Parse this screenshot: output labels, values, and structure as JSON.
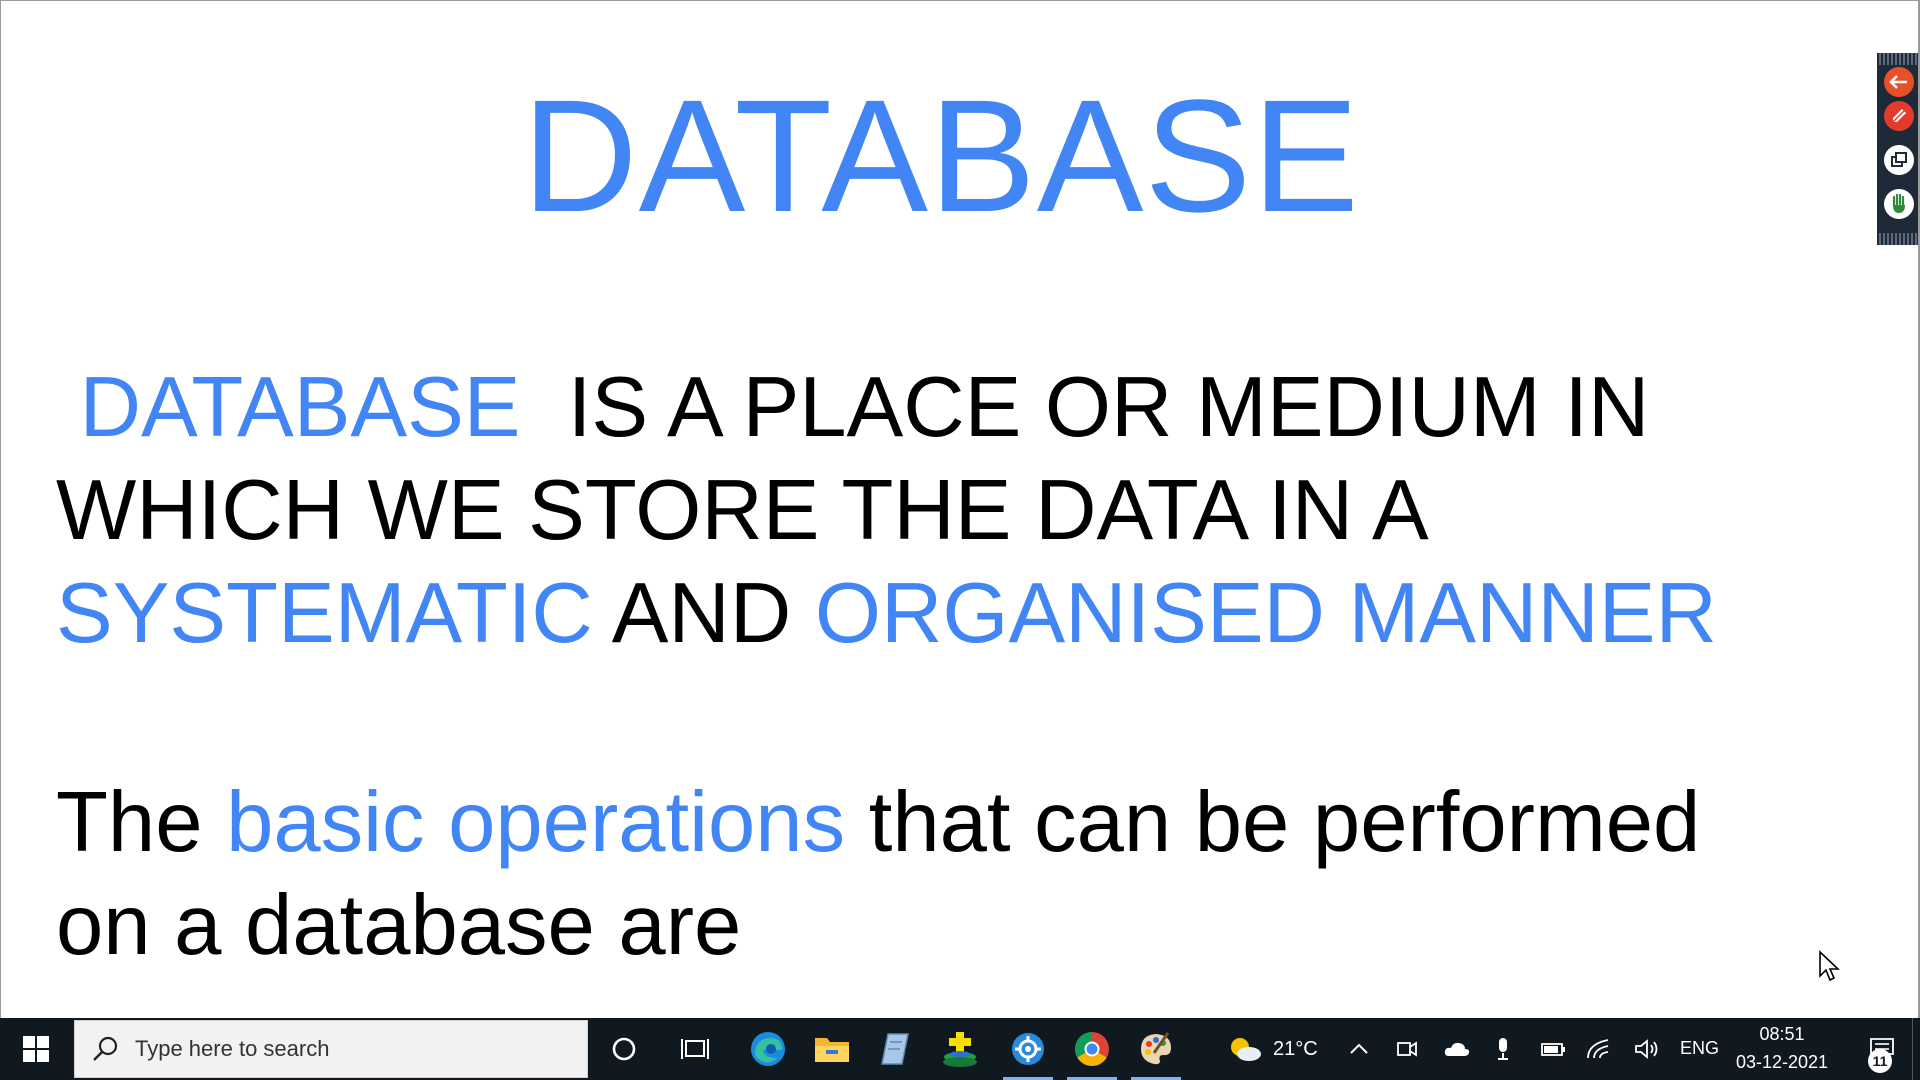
{
  "slide": {
    "title": "DATABASE",
    "para1": {
      "w1": " DATABASE",
      "w2": "  IS A PLACE OR MEDIUM IN",
      "line2": "WHICH WE STORE THE DATA IN A",
      "w3": "SYSTEMATIC",
      "w4": " AND ",
      "w5": "ORGANISED MANNER"
    },
    "para2": {
      "w1": "The ",
      "w2": "basic operations",
      "w3": " that can be performed",
      "line2": "on a database are"
    }
  },
  "float_toolbar": {
    "buttons": [
      "back-arrow",
      "pen-annotate",
      "screen-copy",
      "hand-raise"
    ]
  },
  "taskbar": {
    "search_placeholder": "Type here to search",
    "pinned": [
      "cortana",
      "task-view",
      "edge",
      "file-explorer",
      "notepad",
      "game-app",
      "settings-app",
      "chrome",
      "paint-app"
    ],
    "weather": {
      "temp": "21°C"
    },
    "language": "ENG",
    "clock": {
      "time": "08:51",
      "date": "03-12-2021"
    },
    "notifications": "11"
  },
  "colors": {
    "accent_blue": "#4285f4",
    "taskbar_bg": "#101820"
  }
}
